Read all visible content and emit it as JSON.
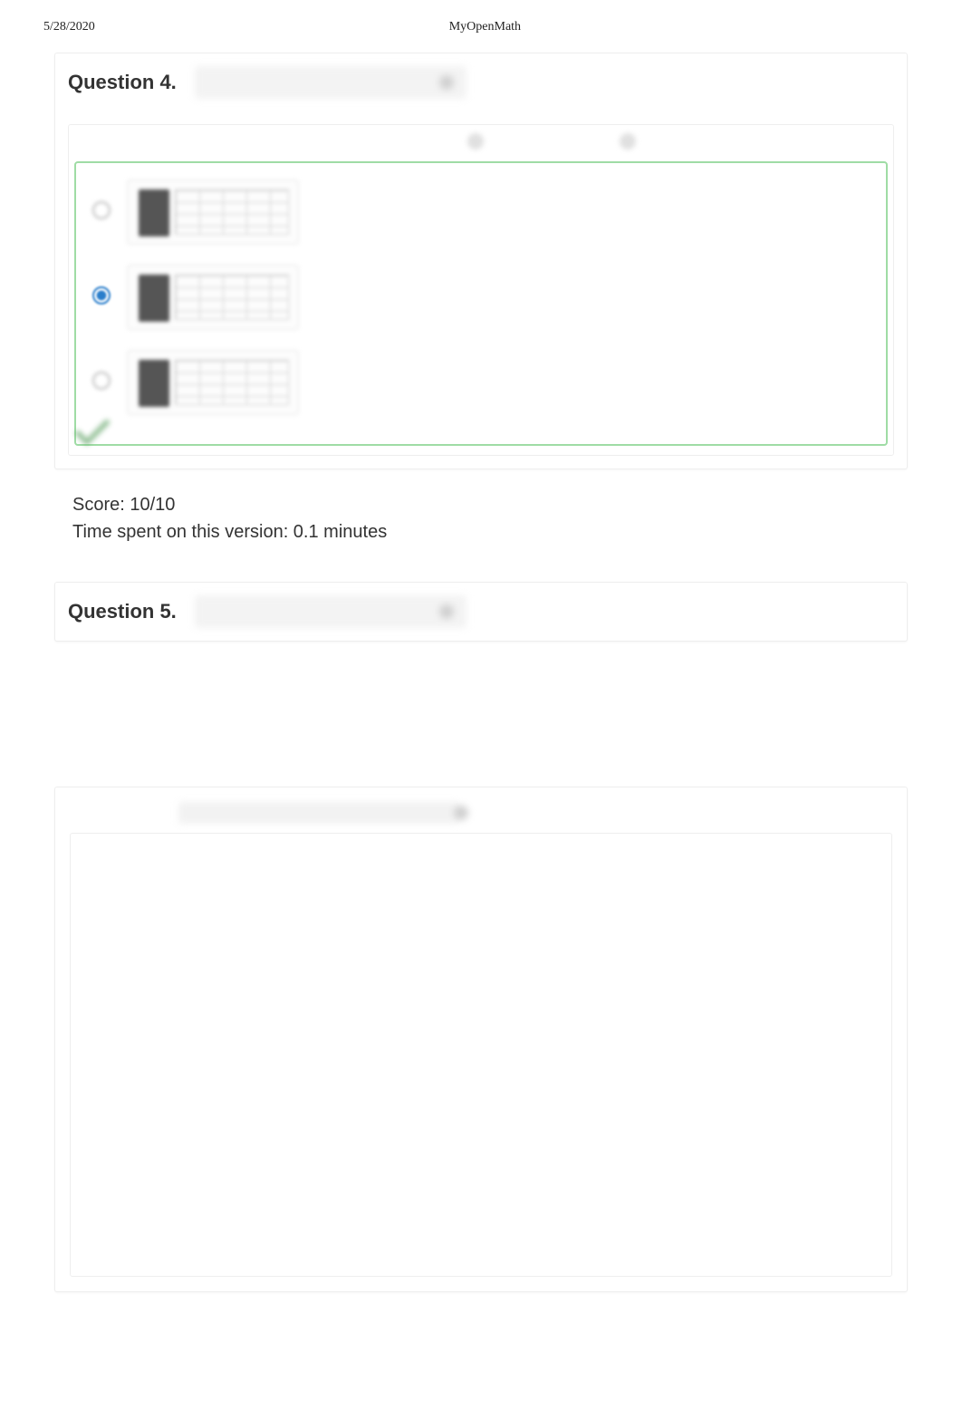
{
  "header": {
    "date": "5/28/2020",
    "title": "MyOpenMath"
  },
  "question4": {
    "label": "Question 4.",
    "score_text": "Score: 10/10",
    "time_text": "Time spent on this version: 0.1 minutes",
    "choices_count": 3,
    "selected_index": 1
  },
  "question5": {
    "label": "Question 5."
  }
}
